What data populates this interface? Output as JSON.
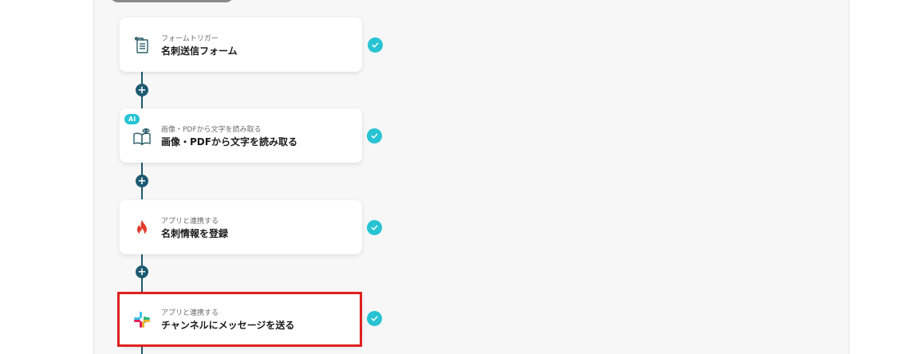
{
  "flow": {
    "steps": [
      {
        "category": "フォームトリガー",
        "title": "名刺送信フォーム",
        "icon": "form-document-icon",
        "completed": true
      },
      {
        "badge": "AI",
        "category": "画像・PDFから文字を読み取る",
        "title": "画像・PDFから文字を読み取る",
        "icon": "ocr-book-eye-icon",
        "completed": true
      },
      {
        "category": "アプリと連携する",
        "title": "名刺情報を登録",
        "icon": "flame-app-icon",
        "completed": true
      },
      {
        "category": "アプリと連携する",
        "title": "チャンネルにメッセージを送る",
        "icon": "slack-icon",
        "completed": true,
        "selected": true
      }
    ],
    "add_button_symbol": "+"
  },
  "colors": {
    "connector": "#1e5a72",
    "check": "#27c3d3",
    "selection": "#e02020",
    "ai_badge": "#25c4d6"
  }
}
